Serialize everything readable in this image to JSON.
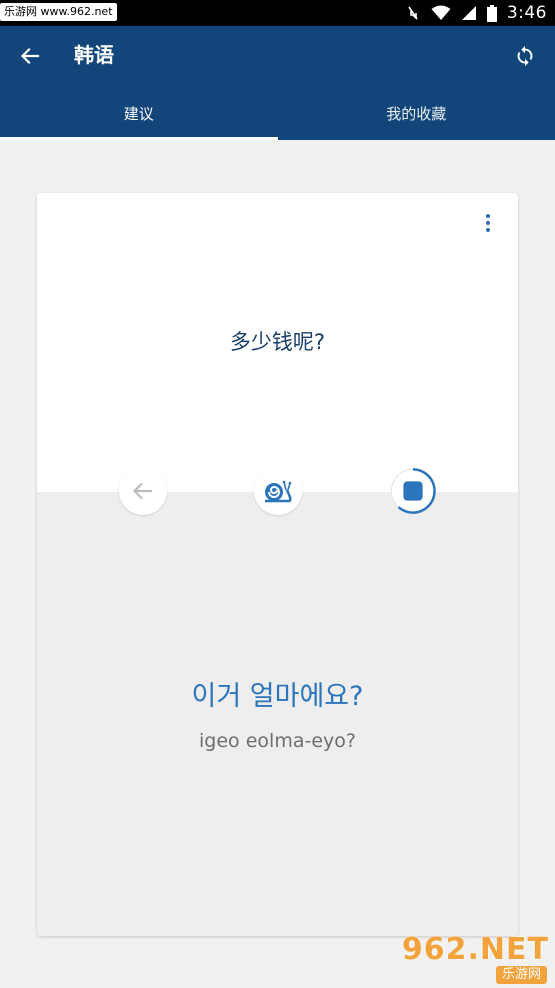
{
  "status_bar": {
    "watermark_badge": "乐游网 www.962.net",
    "time": "3:46"
  },
  "app_bar": {
    "title": "韩语",
    "back_icon": "arrow-left-icon",
    "refresh_icon": "refresh-icon"
  },
  "tabs": [
    {
      "label": "建议",
      "active": true
    },
    {
      "label": "我的收藏",
      "active": false
    }
  ],
  "card": {
    "source_text": "多少钱呢?",
    "target_text": "이거 얼마에요?",
    "romanized_text": "igeo eolma-eyo?",
    "actions": {
      "back_icon": "arrow-left-icon",
      "slow_icon": "snail-icon",
      "stop_icon": "stop-icon"
    }
  },
  "watermark": {
    "main": "962.NET",
    "sub": "乐游网"
  },
  "colors": {
    "primary": "#12467a",
    "accent": "#2a75bb",
    "source_text": "#1a3f6b",
    "romanized_text": "#6e6e6e",
    "background": "#f1f1f1"
  }
}
